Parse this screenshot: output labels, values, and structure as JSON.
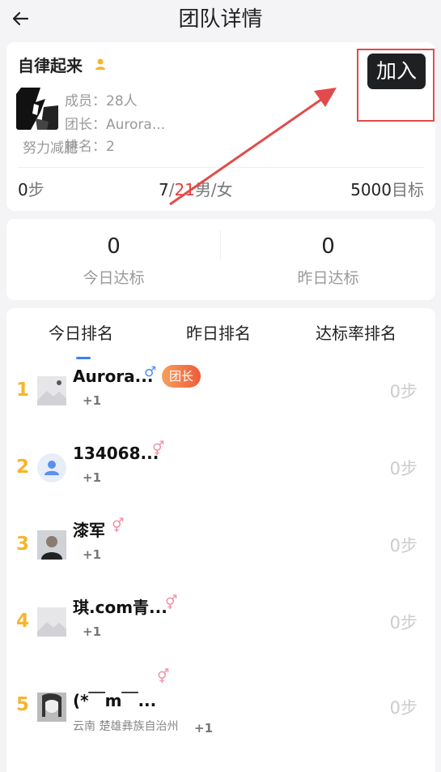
{
  "header": {
    "title": "团队详情"
  },
  "team": {
    "name": "自律起来",
    "members": "成员：28人",
    "leader": "团长：Aurora...",
    "rank_line": "排名：2",
    "slogan": "努力减肥",
    "join_label": "加入",
    "steps_value": "0",
    "steps_unit": "步",
    "gender_male": "7",
    "gender_sep": "/",
    "gender_female": "21",
    "gender_label": "男/女",
    "target_value": "5000",
    "target_label": "目标"
  },
  "rates": {
    "today_value": "0",
    "today_label": "今日达标",
    "yesterday_value": "0",
    "yesterday_label": "昨日达标"
  },
  "tabs": [
    {
      "label": "今日排名",
      "active": true
    },
    {
      "label": "昨日排名",
      "active": false
    },
    {
      "label": "达标率排名",
      "active": false
    }
  ],
  "ranking": [
    {
      "rank": "1",
      "name": "Aurora...",
      "gender": "male",
      "gender_symbol": "♂",
      "badge": "团长",
      "likes": "+1",
      "steps": "0步",
      "location": ""
    },
    {
      "rank": "2",
      "name": "134068...",
      "gender": "female",
      "gender_symbol": "⚥",
      "badge": "",
      "likes": "+1",
      "steps": "0步",
      "location": ""
    },
    {
      "rank": "3",
      "name": "漆军",
      "gender": "female",
      "gender_symbol": "⚥",
      "badge": "",
      "likes": "+1",
      "steps": "0步",
      "location": ""
    },
    {
      "rank": "4",
      "name": "琪.com青...",
      "gender": "female",
      "gender_symbol": "⚥",
      "badge": "",
      "likes": "+1",
      "steps": "0步",
      "location": ""
    },
    {
      "rank": "5",
      "name": "(*￣m￣...",
      "gender": "female",
      "gender_symbol": "⚥",
      "badge": "",
      "likes": "+1",
      "steps": "0步",
      "location": "云南 楚雄彝族自治州"
    }
  ],
  "colors": {
    "accent": "#3a80f0",
    "rank": "#f5b52e",
    "badge": "#ef5b3c",
    "annotation": "#e24b4b"
  },
  "icons": {
    "back": "arrow-left-icon",
    "crown": "crown-icon",
    "male": "male-icon",
    "female": "female-icon"
  }
}
